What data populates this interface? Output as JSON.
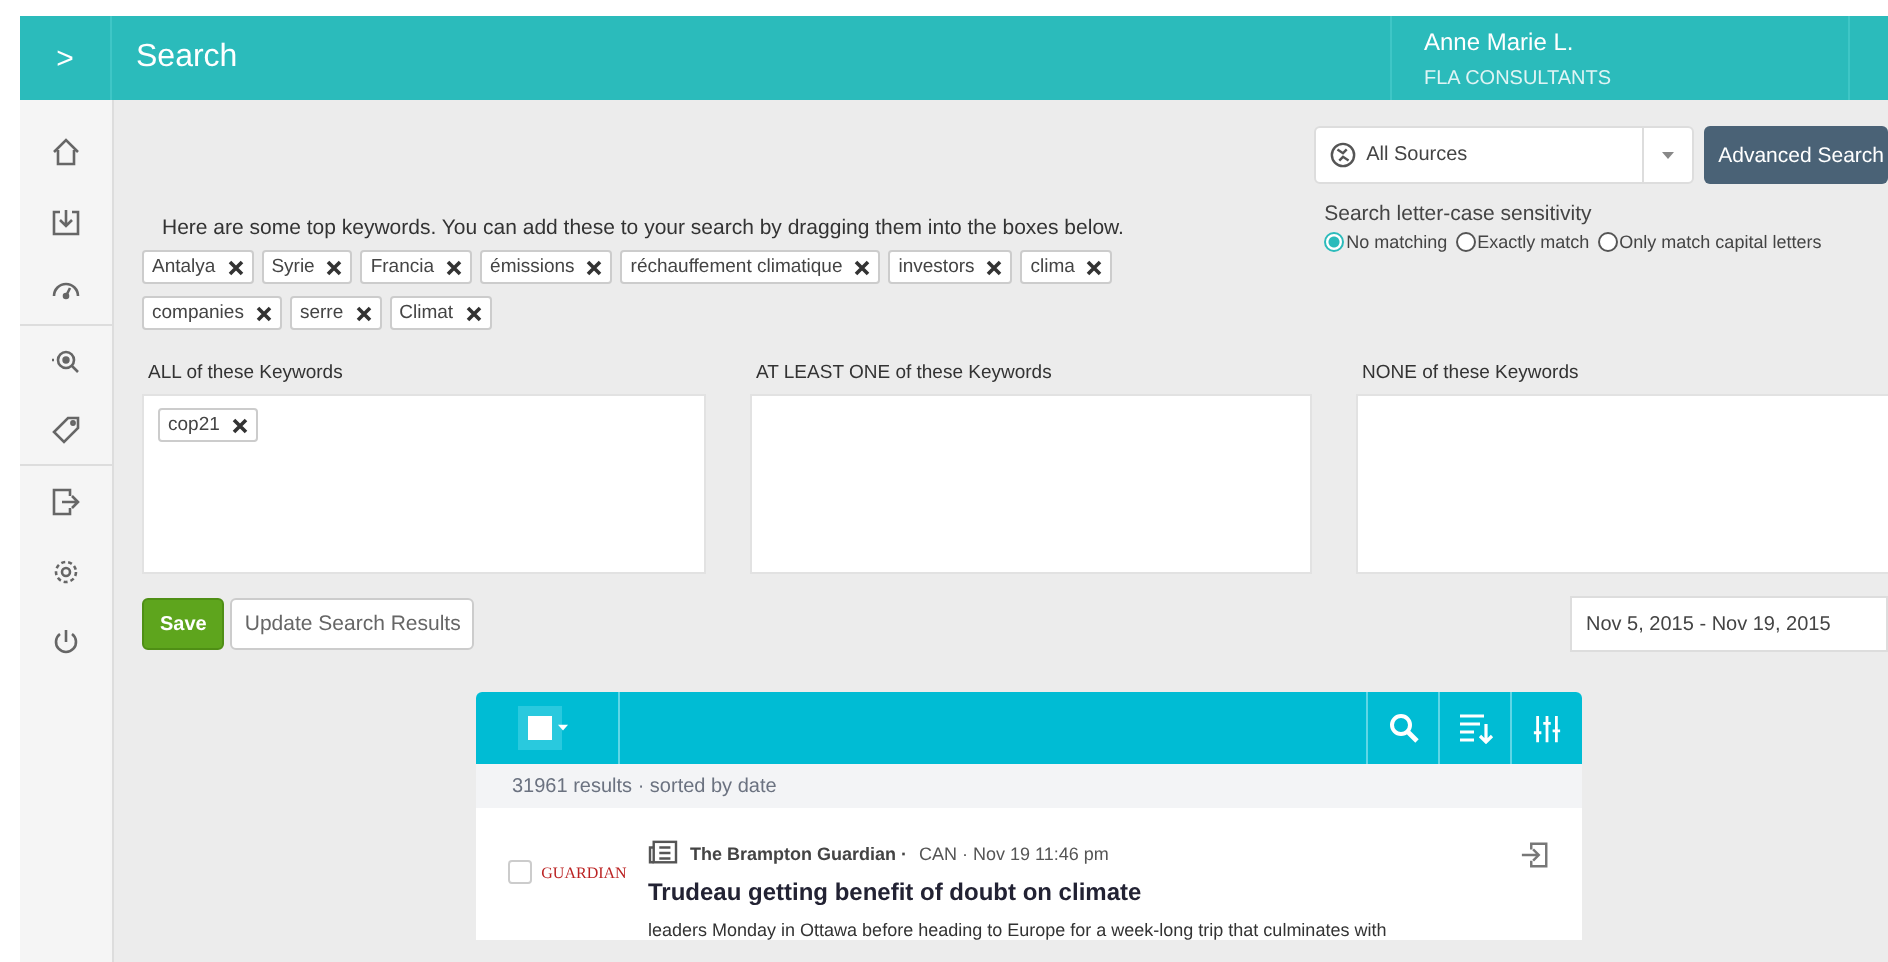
{
  "header": {
    "menu_toggle": ">",
    "title": "Search",
    "user_name": "Anne Marie L.",
    "company": "FLA CONSULTANTS"
  },
  "sidebar": {
    "items": [
      {
        "selected": false
      },
      {
        "selected": false
      },
      {
        "selected": false
      },
      {
        "selected": false
      },
      {
        "selected": false
      },
      {
        "selected": false
      },
      {
        "selected": false
      },
      {
        "selected": false
      }
    ]
  },
  "top_keywords": {
    "hint": "Here are some top keywords. You can add these to your search by dragging them into the boxes below.",
    "tags": [
      "Antalya",
      "Syrie",
      "Francia",
      "émissions",
      "réchauffement climatique",
      "investors",
      "clima",
      "companies",
      "serre",
      "Climat"
    ]
  },
  "sources": {
    "value": "All Sources",
    "button": "Advanced Search"
  },
  "case_sensitivity": {
    "label": "Search letter-case sensitivity",
    "options": [
      {
        "label": "No matching",
        "selected": true
      },
      {
        "label": "Exactly match",
        "selected": false
      },
      {
        "label": "Only match capital letters",
        "selected": false
      }
    ]
  },
  "keyword_boxes": [
    {
      "label": "ALL of these Keywords",
      "tags": [
        "cop21"
      ]
    },
    {
      "label": "AT LEAST ONE of these Keywords"
    },
    {
      "label": "NONE of these Keywords"
    }
  ],
  "actions": {
    "save": "Save",
    "update": "Update Search Results",
    "date_range": "Nov 5, 2015 - Nov 19, 2015"
  },
  "results": {
    "summary": "31961 results · sorted by date",
    "items": [
      {
        "checked": false,
        "logo": "GUARDIAN",
        "source": "The Brampton Guardian ·",
        "meta": "CAN · Nov 19 11:46 pm",
        "headline": "Trudeau getting benefit of doubt on climate",
        "snippet": "leaders Monday in Ottawa before heading to Europe for a week-long trip that culminates with"
      }
    ]
  }
}
